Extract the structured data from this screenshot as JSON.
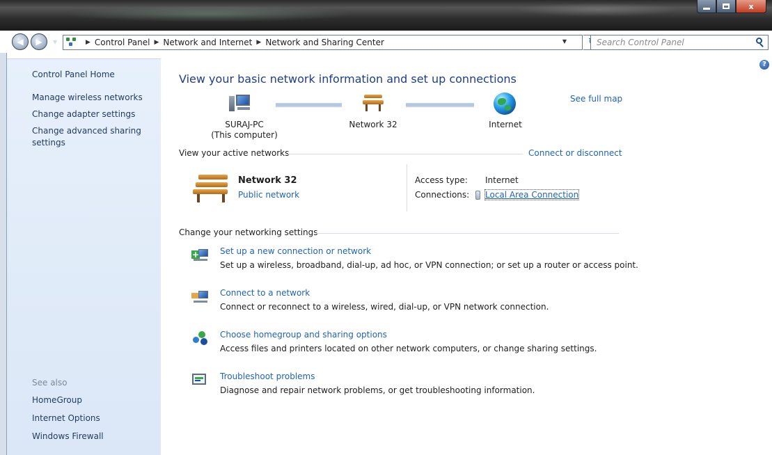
{
  "window": {
    "minimize": "",
    "maximize": "",
    "close": "x"
  },
  "nav": {
    "breadcrumbs": [
      "Control Panel",
      "Network and Internet",
      "Network and Sharing Center"
    ],
    "search_placeholder": "Search Control Panel"
  },
  "sidebar": {
    "home": "Control Panel Home",
    "tasks": [
      "Manage wireless networks",
      "Change adapter settings",
      "Change advanced sharing settings"
    ],
    "see_also_header": "See also",
    "see_also": [
      "HomeGroup",
      "Internet Options",
      "Windows Firewall"
    ]
  },
  "main": {
    "title": "View your basic network information and set up connections",
    "see_full_map": "See full map",
    "map": {
      "computer_name": "SURAJ-PC",
      "computer_sub": "(This computer)",
      "network": "Network  32",
      "internet": "Internet"
    },
    "active_networks_label": "View your active networks",
    "connect_or_disconnect": "Connect or disconnect",
    "active_network": {
      "name": "Network  32",
      "category": "Public network",
      "access_type_label": "Access type:",
      "access_type_value": "Internet",
      "connections_label": "Connections:",
      "connections_value": "Local Area Connection"
    },
    "change_settings_label": "Change your networking settings",
    "tasks": [
      {
        "title": "Set up a new connection or network",
        "desc": "Set up a wireless, broadband, dial-up, ad hoc, or VPN connection; or set up a router or access point."
      },
      {
        "title": "Connect to a network",
        "desc": "Connect or reconnect to a wireless, wired, dial-up, or VPN network connection."
      },
      {
        "title": "Choose homegroup and sharing options",
        "desc": "Access files and printers located on other network computers, or change sharing settings."
      },
      {
        "title": "Troubleshoot problems",
        "desc": "Diagnose and repair network problems, or get troubleshooting information."
      }
    ]
  },
  "colors": {
    "link": "#1f63b7",
    "title": "#1e3d8f",
    "sidebar_bg": "#dbe7f7"
  }
}
